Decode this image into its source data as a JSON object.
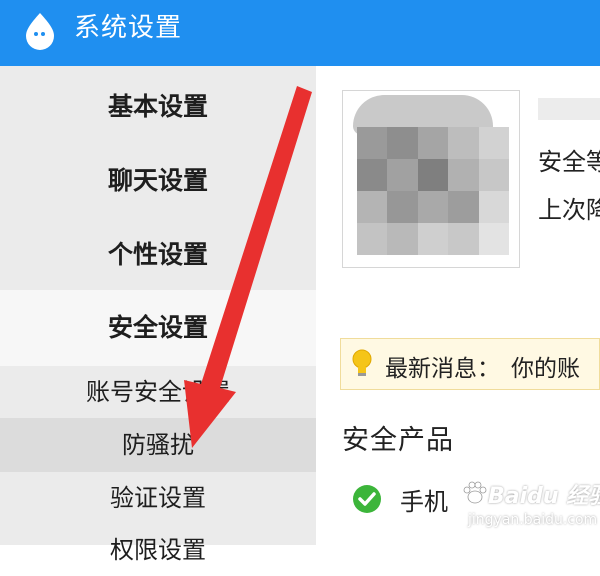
{
  "window": {
    "title": "系统设置",
    "accent_color": "#1f8ff0",
    "logo_icon": "penguin-drop-logo"
  },
  "sidebar": {
    "items": [
      {
        "label": "基本设置"
      },
      {
        "label": "聊天设置"
      },
      {
        "label": "个性设置"
      },
      {
        "label": "安全设置",
        "active": true
      }
    ],
    "sub_items": [
      {
        "label": "账号安全设置"
      },
      {
        "label": "防骚扰",
        "active": true
      },
      {
        "label": "验证设置"
      },
      {
        "label": "权限设置"
      }
    ]
  },
  "profile": {
    "avatar_icon": "user-avatar-blurred",
    "security_line": "安全等",
    "last_login_line": "上次降"
  },
  "news": {
    "icon": "lightbulb-icon",
    "label": "最新消息：",
    "text": "你的账"
  },
  "products": {
    "title": "安全产品",
    "items": [
      {
        "label": "手机",
        "icon": "green-check-icon"
      }
    ]
  },
  "watermark": {
    "main": "Baidu 经验",
    "sub": "jingyan.baidu.com"
  },
  "annotation": {
    "arrow_color": "#e8302f"
  }
}
